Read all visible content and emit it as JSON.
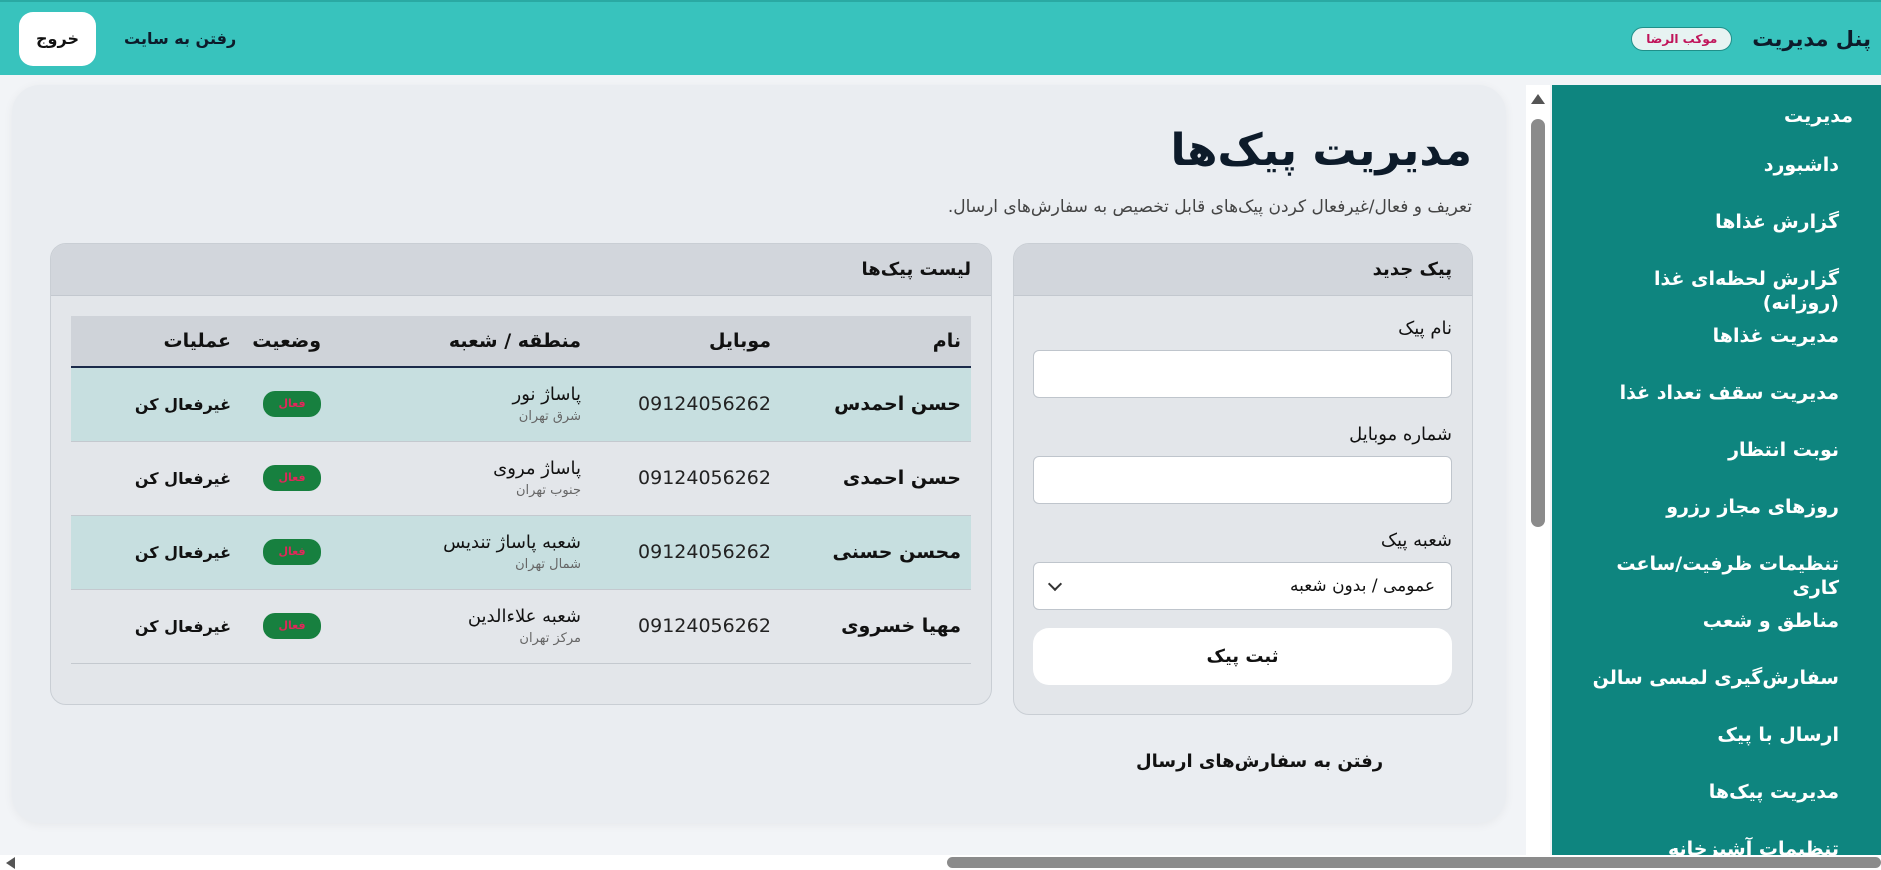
{
  "header": {
    "title": "پنل مدیریت",
    "badge": "موکب الرضا",
    "site_link": "رفتن به سایت",
    "logout": "خروج"
  },
  "sidebar": {
    "heading": "مدیریت",
    "items": [
      {
        "label": "داشبورد"
      },
      {
        "label": "گزارش غذاها"
      },
      {
        "label": "گزارش لحظه‌ای غذا (روزانه)"
      },
      {
        "label": "مدیریت غذاها"
      },
      {
        "label": "مدیریت سقف تعداد غذا"
      },
      {
        "label": "نوبت انتظار"
      },
      {
        "label": "روزهای مجاز رزرو"
      },
      {
        "label": "تنظیمات ظرفیت/ساعت کاری"
      },
      {
        "label": "مناطق و شعب"
      },
      {
        "label": "سفارش‌گیری لمسی سالن"
      },
      {
        "label": "ارسال با پیک"
      },
      {
        "label": "مدیریت پیک‌ها"
      },
      {
        "label": "تنظیمات آشپزخانه"
      }
    ]
  },
  "page": {
    "title": "مدیریت پیک‌ها",
    "subtitle": "تعریف و فعال/غیرفعال کردن پیک‌های قابل تخصیص به سفارش‌های ارسال."
  },
  "form": {
    "title": "پیک جدید",
    "name_label": "نام پیک",
    "name_value": "",
    "mobile_label": "شماره موبایل",
    "mobile_value": "",
    "branch_label": "شعبه پیک",
    "branch_value": "عمومی / بدون شعبه",
    "submit": "ثبت پیک"
  },
  "list": {
    "title": "لیست پیک‌ها",
    "columns": {
      "name": "نام",
      "mobile": "موبایل",
      "area": "منطقه / شعبه",
      "status": "وضعیت",
      "actions": "عملیات"
    },
    "rows": [
      {
        "name": "حسن احمدس",
        "mobile": "09124056262",
        "area": "پاساژ نور",
        "region": "شرق تهران",
        "status": "فعال",
        "action": "غیرفعال کن"
      },
      {
        "name": "حسن احمدی",
        "mobile": "09124056262",
        "area": "پاساژ مروی",
        "region": "جنوب تهران",
        "status": "فعال",
        "action": "غیرفعال کن"
      },
      {
        "name": "محسن حسنی",
        "mobile": "09124056262",
        "area": "شعبه پاساژ تندیس",
        "region": "شمال تهران",
        "status": "فعال",
        "action": "غیرفعال کن"
      },
      {
        "name": "مهیا خسروی",
        "mobile": "09124056262",
        "area": "شعبه علاءالدین",
        "region": "مرکز تهران",
        "status": "فعال",
        "action": "غیرفعال کن"
      }
    ]
  },
  "footer_link": "رفتن به سفارش‌های ارسال",
  "colors": {
    "topbar": "#38c3bd",
    "sidebar": "#0e857f",
    "status_badge": "#17803f",
    "status_text": "#e0285a"
  }
}
